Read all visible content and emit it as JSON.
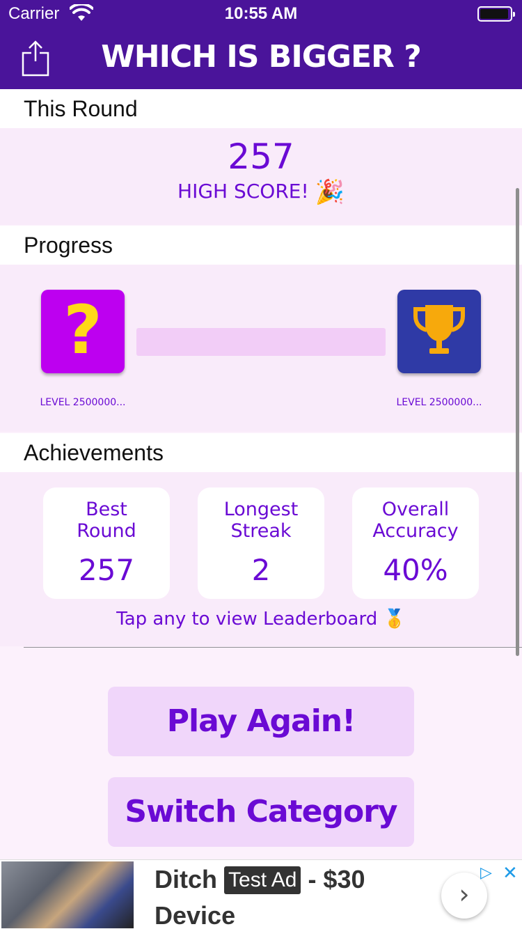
{
  "status_bar": {
    "carrier": "Carrier",
    "time": "10:55 AM"
  },
  "nav": {
    "title": "WHICH IS BIGGER ?",
    "share_icon": "share-icon"
  },
  "this_round": {
    "header": "This Round",
    "score": "257",
    "subtitle": "HIGH SCORE!",
    "subtitle_icon": "party-popper-icon"
  },
  "progress": {
    "header": "Progress",
    "start_icon": "question-mark-icon",
    "end_icon": "trophy-icon",
    "start_label": "LEVEL 2500000...",
    "end_label": "LEVEL 2500000...",
    "fill_fraction": 0.0
  },
  "achievements": {
    "header": "Achievements",
    "cards": [
      {
        "label": "Best Round",
        "value": "257"
      },
      {
        "label": "Longest Streak",
        "value": "2"
      },
      {
        "label": "Overall Accuracy",
        "value": "40%"
      }
    ],
    "hint": "Tap any to view Leaderboard",
    "hint_icon": "medal-icon"
  },
  "buttons": {
    "play_again": "Play Again!",
    "switch_category": "Switch Category"
  },
  "ad": {
    "headline_start": "Ditch",
    "tag": "Test Ad",
    "headline_end": "- $30",
    "headline_line2": "Device",
    "next_icon": "chevron-right-icon",
    "choices_icon": "ad-choices-icon",
    "close_icon": "close-icon"
  },
  "colors": {
    "nav_background": "#4a149a",
    "accent": "#6a0ad4",
    "section_background": "#f9ebfa",
    "button_background": "#f0d6fa",
    "start_box": "#bd00f0",
    "end_box": "#2f3aa6",
    "trophy": "#f7a90c"
  }
}
